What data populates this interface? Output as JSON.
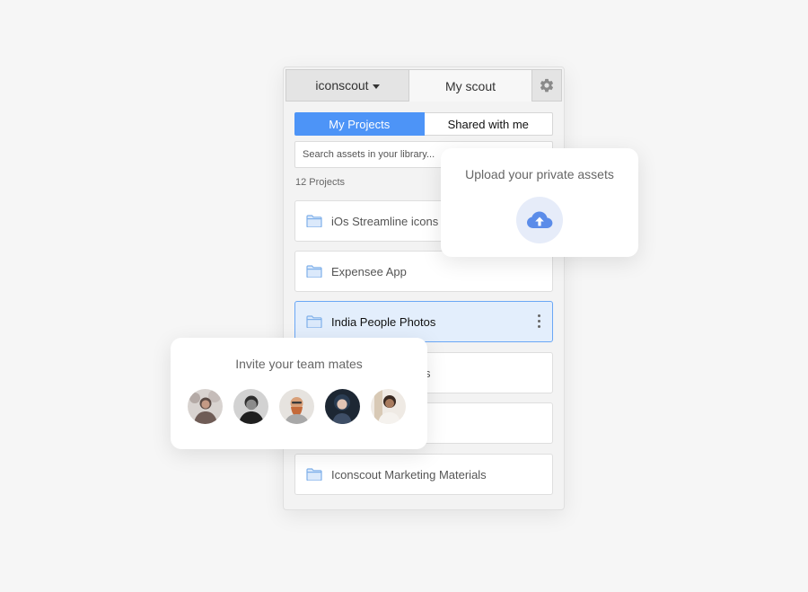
{
  "header": {
    "account_label": "iconscout",
    "myscout_label": "My scout",
    "settings_icon": "gear-icon"
  },
  "tabs": {
    "my_projects": "My Projects",
    "shared": "Shared with me"
  },
  "search": {
    "placeholder": "Search assets in your library..."
  },
  "projects_count": "12 Projects",
  "projects": [
    {
      "label": "iOs Streamline icons",
      "icon": "folder-icon"
    },
    {
      "label": "Expensee App",
      "icon": "folder-icon"
    },
    {
      "label": "India People Photos",
      "icon": "folder-icon",
      "selected": true
    },
    {
      "label": "s",
      "icon": "folder-icon"
    },
    {
      "label": "",
      "icon": "folder-icon"
    },
    {
      "label": "Iconscout Marketing Materials",
      "icon": "folder-icon"
    }
  ],
  "upload_card": {
    "title": "Upload your private assets",
    "icon": "cloud-upload-icon"
  },
  "invite_card": {
    "title": "Invite your team mates",
    "avatar_count": 5
  },
  "colors": {
    "accent": "#4d94f7",
    "selected_bg": "#e3eefc",
    "folder": "#7fb0ea"
  }
}
